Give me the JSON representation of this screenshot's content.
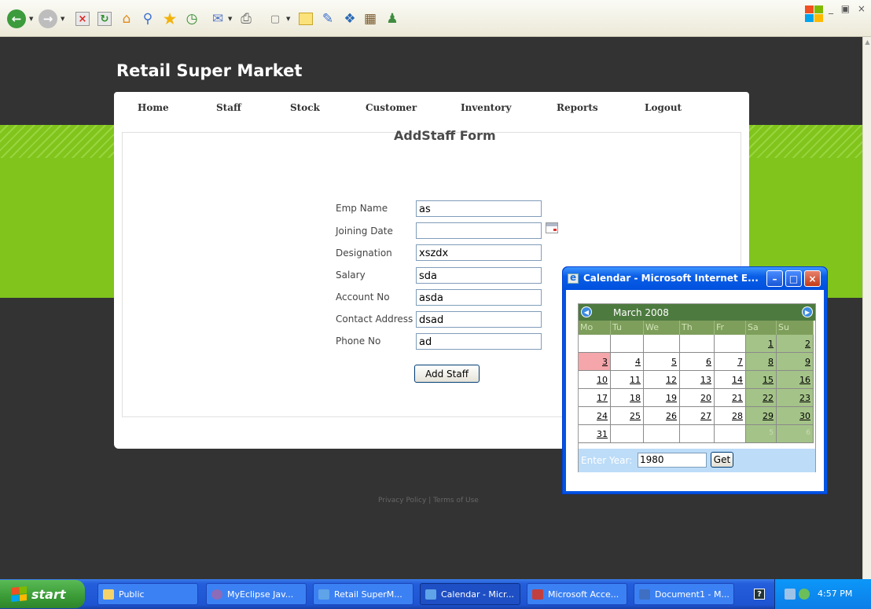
{
  "toolbar": {
    "icons": [
      "back-icon",
      "forward-icon",
      "stop-icon",
      "refresh-icon",
      "home-icon",
      "search-icon",
      "favorites-icon",
      "history-icon",
      "mail-icon",
      "print-icon",
      "edit-icon",
      "notes-icon",
      "messenger-icon",
      "research-icon",
      "bluetooth-icon",
      "contacts-icon"
    ]
  },
  "site": {
    "title": "Retail Super Market",
    "nav": [
      "Home",
      "Staff",
      "Stock",
      "Customer",
      "Inventory",
      "Reports",
      "Logout"
    ],
    "footer": "Privacy Policy | Terms of Use"
  },
  "form": {
    "title": "AddStaff Form",
    "fields": [
      {
        "label": "Emp Name",
        "value": "as"
      },
      {
        "label": "Joining Date",
        "value": ""
      },
      {
        "label": "Designation",
        "value": "xszdx"
      },
      {
        "label": "Salary",
        "value": "sda"
      },
      {
        "label": "Account No",
        "value": "asda"
      },
      {
        "label": "Contact Address",
        "value": "dsad"
      },
      {
        "label": "Phone No",
        "value": "ad"
      }
    ],
    "submit_label": "Add Staff"
  },
  "popup": {
    "title": "Calendar - Microsoft Internet E...",
    "calendar": {
      "month": "March 2008",
      "weekdays": [
        "Mo",
        "Tu",
        "We",
        "Th",
        "Fr",
        "Sa",
        "Su"
      ],
      "weeks": [
        [
          "",
          "",
          "",
          "",
          "",
          "1",
          "2"
        ],
        [
          "3",
          "4",
          "5",
          "6",
          "7",
          "8",
          "9"
        ],
        [
          "10",
          "11",
          "12",
          "13",
          "14",
          "15",
          "16"
        ],
        [
          "17",
          "18",
          "19",
          "20",
          "21",
          "22",
          "23"
        ],
        [
          "24",
          "25",
          "26",
          "27",
          "28",
          "29",
          "30"
        ],
        [
          "31",
          "",
          "",
          "",
          "",
          "5",
          "6"
        ]
      ],
      "today": "3",
      "year_label": "Enter Year:",
      "year_value": "1980",
      "get_label": "Get"
    }
  },
  "taskbar": {
    "start_label": "start",
    "items": [
      "Public",
      "MyEclipse Jav...",
      "Retail SuperM...",
      "Calendar - Micr...",
      "Microsoft Acce...",
      "Document1 - M..."
    ],
    "active_index": 3,
    "clock": "4:57 PM"
  }
}
